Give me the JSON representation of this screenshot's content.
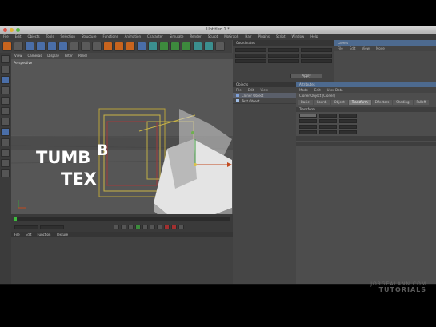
{
  "window": {
    "title": "Untitled 1 *"
  },
  "menubar": {
    "items": [
      "File",
      "Edit",
      "Objects",
      "Tools",
      "Selection",
      "Structure",
      "Functions",
      "Animation",
      "Character",
      "Simulate",
      "Render",
      "Sculpt",
      "MoGraph",
      "Hair",
      "Plugins",
      "Script",
      "Window",
      "Help"
    ]
  },
  "viewport": {
    "menu": [
      "View",
      "Cameras",
      "Display",
      "Filter",
      "Panel"
    ],
    "label": "Perspective",
    "text_line1": "TUMB",
    "text_line2": "TEX",
    "text_overlay": "B"
  },
  "coordinates": {
    "title": "Coordinates",
    "apply_label": "Apply"
  },
  "layers": {
    "title": "Layers",
    "menu": [
      "File",
      "Edit",
      "View",
      "Mode"
    ]
  },
  "objects": {
    "title": "Objects",
    "menu": [
      "File",
      "Edit",
      "View"
    ],
    "items": [
      "Cloner Object",
      "Text Object"
    ]
  },
  "attributes": {
    "title": "Attributes",
    "menu": [
      "Mode",
      "Edit",
      "User Data"
    ],
    "object_label": "Cloner Object [Cloner]",
    "tabs": [
      "Basic",
      "Coord.",
      "Object",
      "Transform",
      "Effectors",
      "Shading",
      "Falloff"
    ],
    "section": "Transform"
  },
  "materials": {
    "menu": [
      "File",
      "Edit",
      "Function",
      "Texture"
    ]
  },
  "watermark": {
    "line1": "JORGEALANN.COM",
    "line2": "TUTORIALS"
  }
}
